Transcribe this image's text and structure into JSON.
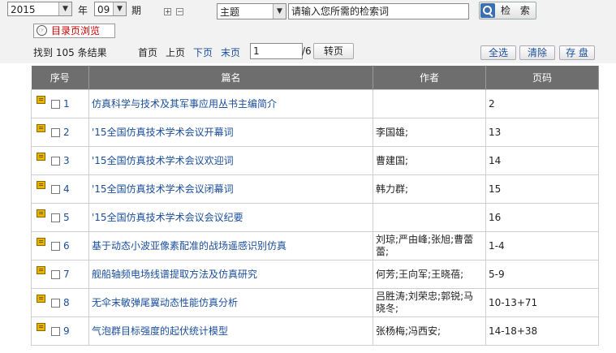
{
  "filters": {
    "year": "2015",
    "year_label": "年",
    "period": "09",
    "period_label": "期",
    "expand": "+",
    "collapse": "−",
    "field": "主题",
    "search_placeholder": "请输入您所需的检索词",
    "search_button": "检 索",
    "directory_button": "目录页浏览"
  },
  "results": {
    "prefix": "找到",
    "count": "105",
    "suffix": "条结果",
    "first": "首页",
    "prev": "上页",
    "next": "下页",
    "last": "末页",
    "page_value": "1",
    "total_pages": "/6",
    "go": "转页",
    "select_all": "全选",
    "clear": "清除",
    "save": "存 盘"
  },
  "table": {
    "columns": [
      "序号",
      "篇名",
      "作者",
      "页码"
    ],
    "rows": [
      {
        "no": "1",
        "title": "仿真科学与技术及其军事应用丛书主编简介",
        "author": "",
        "pages": "2"
      },
      {
        "no": "2",
        "title": "'15全国仿真技术学术会议开幕词",
        "author": "李国雄;",
        "pages": "13"
      },
      {
        "no": "3",
        "title": "'15全国仿真技术学术会议欢迎词",
        "author": "曹建国;",
        "pages": "14"
      },
      {
        "no": "4",
        "title": "'15全国仿真技术学术会议闭幕词",
        "author": "韩力群;",
        "pages": "15"
      },
      {
        "no": "5",
        "title": "'15全国仿真技术学术会议会议纪要",
        "author": "",
        "pages": "16"
      },
      {
        "no": "6",
        "title": "基于动态小波亚像素配准的战场遥感识别仿真",
        "author": "刘琼;严由峰;张旭;曹蕾蕾;",
        "pages": "1-4"
      },
      {
        "no": "7",
        "title": "舰船轴频电场线谱提取方法及仿真研究",
        "author": "何芳;王向军;王晓蓓;",
        "pages": "5-9"
      },
      {
        "no": "8",
        "title": "无伞末敏弹尾翼动态性能仿真分析",
        "author": "吕胜涛;刘荣忠;郭锐;马晓冬;",
        "pages": "10-13+71"
      },
      {
        "no": "9",
        "title": "气泡群目标强度的起伏统计模型",
        "author": "张杨梅;冯西安;",
        "pages": "14-18+38"
      }
    ]
  }
}
